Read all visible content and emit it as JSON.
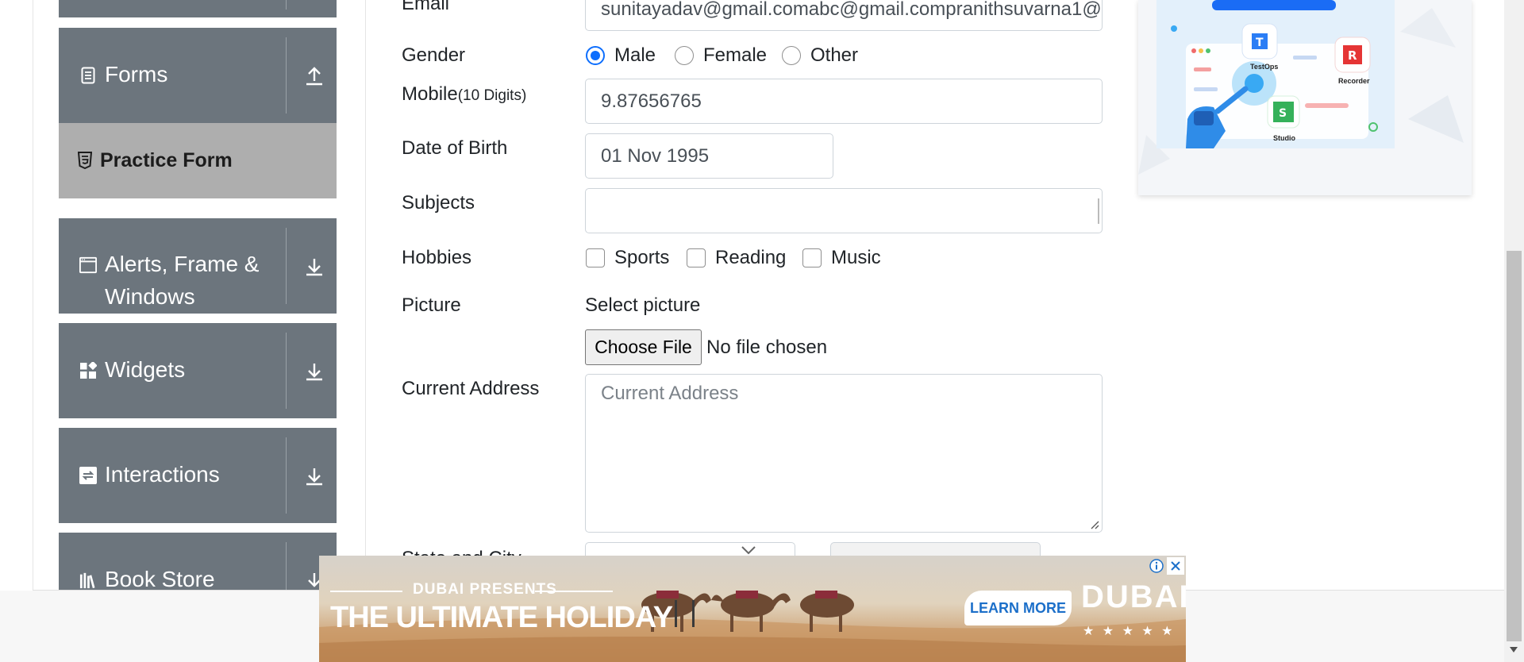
{
  "sidebar": {
    "forms": {
      "label": "Forms",
      "icon": "document-icon",
      "arrow": "upload-arrow-icon"
    },
    "practice_form": {
      "label": "Practice Form",
      "icon": "html5-icon"
    },
    "alerts": {
      "label_line1": "Alerts, Frame &",
      "label_line2": "Windows",
      "icon": "window-icon",
      "arrow": "download-arrow-icon"
    },
    "widgets": {
      "label": "Widgets",
      "icon": "widgets-icon",
      "arrow": "download-arrow-icon"
    },
    "interactions": {
      "label": "Interactions",
      "icon": "swap-icon",
      "arrow": "download-arrow-icon"
    },
    "book_store": {
      "label": "Book Store",
      "icon": "books-icon",
      "arrow": "download-arrow-icon"
    }
  },
  "form": {
    "email_label": "Email",
    "email_value": "sunitayadav@gmail.comabc@gmail.compranithsuvarna1@",
    "gender_label": "Gender",
    "gender_options": [
      "Male",
      "Female",
      "Other"
    ],
    "gender_selected": "Male",
    "mobile_label": "Mobile",
    "mobile_hint": "(10 Digits)",
    "mobile_value": "9.87656765",
    "dob_label": "Date of Birth",
    "dob_value": "01 Nov 1995",
    "subjects_label": "Subjects",
    "subjects_value": "",
    "hobbies_label": "Hobbies",
    "hobbies": [
      "Sports",
      "Reading",
      "Music"
    ],
    "picture_label": "Picture",
    "select_picture": "Select picture",
    "choose_file": "Choose File",
    "no_file": "No file chosen",
    "address_label": "Current Address",
    "address_placeholder": "Current Address",
    "state_city_label": "State and City"
  },
  "ad_right": {
    "labels": [
      "TestOps",
      "Recorder",
      "Studio"
    ],
    "accent": "#1a6cf5"
  },
  "ad_bottom": {
    "presents": "DUBAI PRESENTS",
    "headline": "THE ULTIMATE HOLIDAY",
    "cta": "LEARN MORE",
    "brand": "DUBAI",
    "stars": "★ ★ ★ ★ ★"
  },
  "colors": {
    "sidebar_group": "#6c757d",
    "active_item": "#aeaeae",
    "radio_checked": "#0d6efd"
  }
}
